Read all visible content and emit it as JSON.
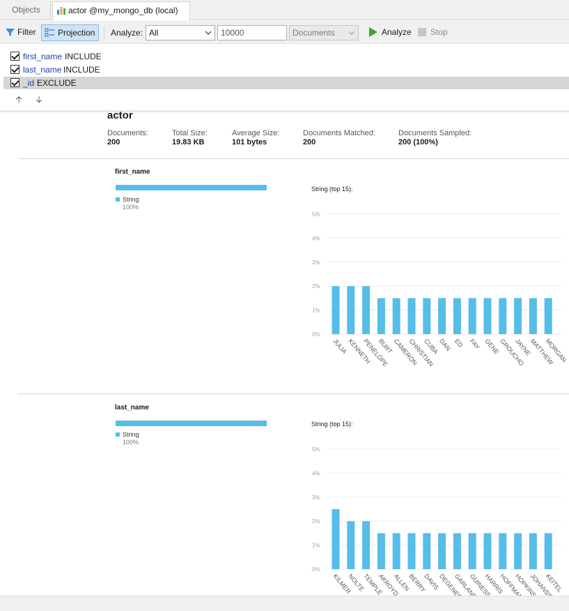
{
  "tabs": {
    "objects_label": "Objects",
    "active_label": "actor @my_mongo_db (local) ..."
  },
  "toolbar": {
    "filter_label": "Filter",
    "projection_label": "Projection",
    "analyze_label": "Analyze:",
    "scope_value": "All",
    "limit_value": "10000",
    "unit_value": "Documents",
    "run_label": "Analyze",
    "stop_label": "Stop"
  },
  "projection": [
    {
      "field": "first_name",
      "mode": "INCLUDE",
      "checked": true
    },
    {
      "field": "last_name",
      "mode": "INCLUDE",
      "checked": true
    },
    {
      "field": "_id",
      "mode": "EXCLUDE",
      "checked": true
    }
  ],
  "collection": {
    "name": "actor",
    "stats": [
      {
        "label": "Documents:",
        "value": "200"
      },
      {
        "label": "Total Size:",
        "value": "19.83 KB"
      },
      {
        "label": "Average Size:",
        "value": "101 bytes"
      },
      {
        "label": "Documents Matched:",
        "value": "200"
      },
      {
        "label": "Documents Sampled:",
        "value": "200 (100%)"
      }
    ]
  },
  "fields": [
    {
      "name": "first_name",
      "type_name": "String",
      "type_pct": "100%",
      "type_fraction": 1.0,
      "chart_title": "String (top 15):"
    },
    {
      "name": "last_name",
      "type_name": "String",
      "type_pct": "100%",
      "type_fraction": 1.0,
      "chart_title": "String (top 15):"
    }
  ],
  "colors": {
    "bar": "#56bde9",
    "accent_link": "#1a3fa8",
    "run_green": "#3aa72f"
  },
  "chart_data": [
    {
      "type": "bar",
      "title": "String (top 15):",
      "categories": [
        "JULIA",
        "KENNETH",
        "PENELOPE",
        "BURT",
        "CAMERON",
        "CHRISTIAN",
        "CUBA",
        "DAN",
        "ED",
        "FAY",
        "GENE",
        "GROUCHO",
        "JAYNE",
        "MATTHEW",
        "MORGAN"
      ],
      "values": [
        2,
        2,
        2,
        1.5,
        1.5,
        1.5,
        1.5,
        1.5,
        1.5,
        1.5,
        1.5,
        1.5,
        1.5,
        1.5,
        1.5
      ],
      "yticks": [
        "0%",
        "1%",
        "2%",
        "3%",
        "4%",
        "5%"
      ],
      "ylim": [
        0,
        5
      ],
      "grid": true
    },
    {
      "type": "bar",
      "title": "String (top 15):",
      "categories": [
        "KILMER",
        "NOLTE",
        "TEMPLE",
        "AKROYD",
        "ALLEN",
        "BERRY",
        "DAVIS",
        "DEGENERES",
        "GARLAND",
        "GUINESS",
        "HARRIS",
        "HOFFMAN",
        "HOPKINS",
        "JOHANSSON",
        "KEITEL"
      ],
      "values": [
        2.5,
        2,
        2,
        1.5,
        1.5,
        1.5,
        1.5,
        1.5,
        1.5,
        1.5,
        1.5,
        1.5,
        1.5,
        1.5,
        1.5
      ],
      "yticks": [
        "0%",
        "1%",
        "2%",
        "3%",
        "4%",
        "5%"
      ],
      "ylim": [
        0,
        5
      ],
      "grid": true
    }
  ]
}
